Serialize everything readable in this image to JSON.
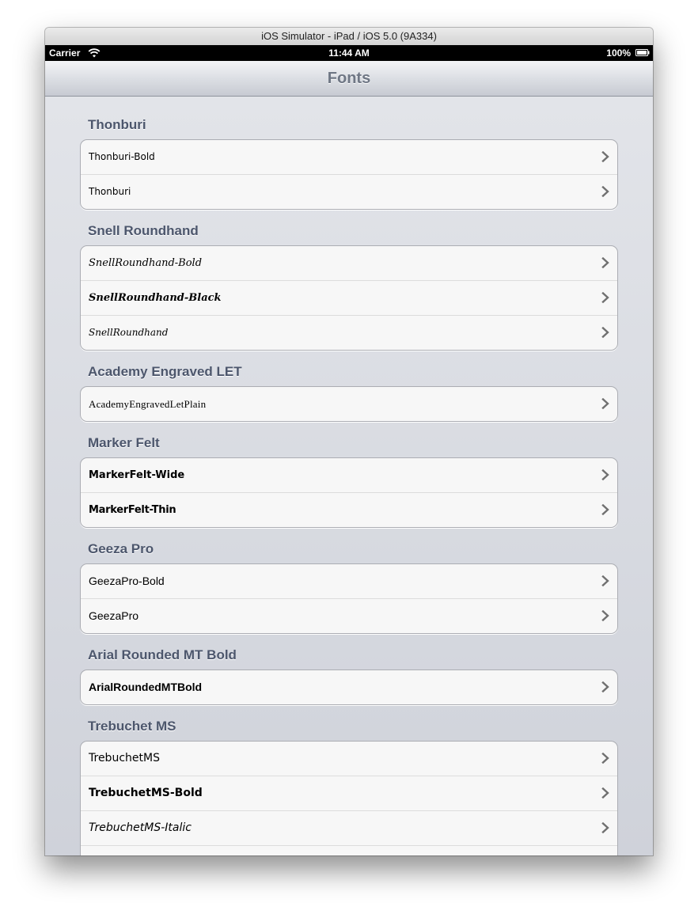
{
  "window": {
    "title": "iOS Simulator - iPad / iOS 5.0 (9A334)"
  },
  "status_bar": {
    "carrier": "Carrier",
    "wifi_icon": "wifi-icon",
    "time": "11:44 AM",
    "battery_percent": "100%",
    "battery_icon": "battery-icon",
    "battery_level": 1.0
  },
  "nav_bar": {
    "title": "Fonts"
  },
  "sections": [
    {
      "header": "Thonburi",
      "rows": [
        {
          "label": "Thonburi-Bold"
        },
        {
          "label": "Thonburi"
        }
      ]
    },
    {
      "header": "Snell Roundhand",
      "rows": [
        {
          "label": "SnellRoundhand-Bold"
        },
        {
          "label": "SnellRoundhand-Black"
        },
        {
          "label": "SnellRoundhand"
        }
      ]
    },
    {
      "header": "Academy Engraved LET",
      "rows": [
        {
          "label": "AcademyEngravedLetPlain"
        }
      ]
    },
    {
      "header": "Marker Felt",
      "rows": [
        {
          "label": "MarkerFelt-Wide"
        },
        {
          "label": "MarkerFelt-Thin"
        }
      ]
    },
    {
      "header": "Geeza Pro",
      "rows": [
        {
          "label": "GeezaPro-Bold"
        },
        {
          "label": "GeezaPro"
        }
      ]
    },
    {
      "header": "Arial Rounded MT Bold",
      "rows": [
        {
          "label": "ArialRoundedMTBold"
        }
      ]
    },
    {
      "header": "Trebuchet MS",
      "rows": [
        {
          "label": "TrebuchetMS"
        },
        {
          "label": "TrebuchetMS-Bold"
        },
        {
          "label": "TrebuchetMS-Italic"
        }
      ]
    }
  ],
  "row_accessory_icon": "chevron-right-icon",
  "colors": {
    "section_header": "#4c566c",
    "nav_title": "#6f7785",
    "background": "#dfe1e6",
    "cell_background": "#f7f7f7",
    "chevron": "#707070"
  }
}
